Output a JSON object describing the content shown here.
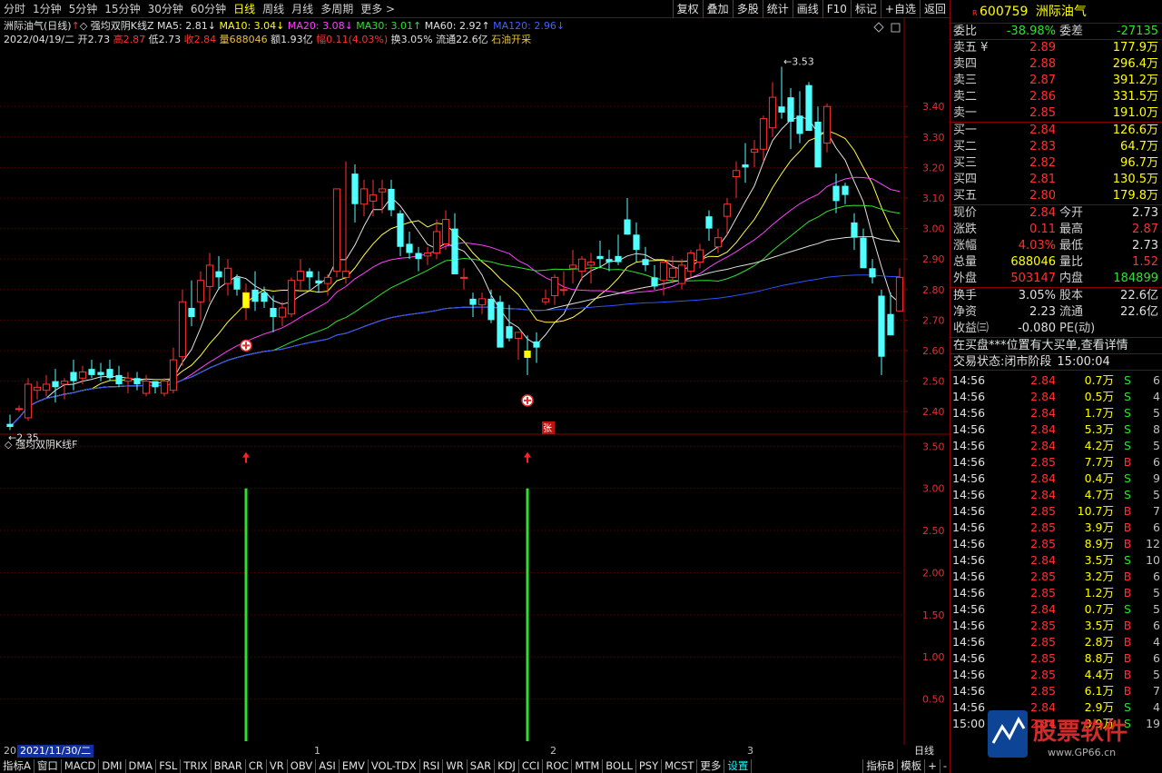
{
  "toolbar": {
    "periods": [
      "分时",
      "1分钟",
      "5分钟",
      "15分钟",
      "30分钟",
      "60分钟",
      "日线",
      "周线",
      "月线",
      "多周期",
      "更多 >"
    ],
    "active_period": "日线",
    "right_buttons": [
      "复权",
      "叠加",
      "多股",
      "统计",
      "画线",
      "F10",
      "标记",
      "+自选",
      "返回"
    ]
  },
  "info": {
    "line1": [
      {
        "t": "洲际油气(日线)",
        "c": "c-white"
      },
      {
        "t": "↑",
        "c": "c-red"
      },
      {
        "t": "◇ 强均双阴K线Z",
        "c": "c-white"
      },
      {
        "t": " MA5: 2.81↓",
        "c": "c-white"
      },
      {
        "t": " MA10: 3.04↓",
        "c": "c-yellow"
      },
      {
        "t": " MA20: 3.08↓",
        "c": "c-mag"
      },
      {
        "t": " MA30: 3.01↑",
        "c": "c-green"
      },
      {
        "t": " MA60: 2.92↑",
        "c": "c-white"
      },
      {
        "t": " MA120: 2.96↓",
        "c": "c-blue"
      }
    ],
    "line2": [
      {
        "t": "2022/04/19/二",
        "c": "c-white"
      },
      {
        "t": " 开2.73",
        "c": "c-white"
      },
      {
        "t": " 高2.87",
        "c": "c-red"
      },
      {
        "t": " 低2.73",
        "c": "c-white"
      },
      {
        "t": " 收2.84",
        "c": "c-red"
      },
      {
        "t": " 量688046",
        "c": "c-gold"
      },
      {
        "t": " 额1.93亿",
        "c": "c-white"
      },
      {
        "t": " 幅0.11(4.03%)",
        "c": "c-red"
      },
      {
        "t": " 换3.05%",
        "c": "c-white"
      },
      {
        "t": " 流通22.6亿",
        "c": "c-white"
      },
      {
        "t": " 石油开采",
        "c": "c-gold"
      }
    ]
  },
  "chart_data": [
    {
      "type": "candlestick",
      "title": "洲际油气(日线)",
      "yticks": [
        2.4,
        2.5,
        2.6,
        2.7,
        2.8,
        2.9,
        3.0,
        3.1,
        3.2,
        3.3,
        3.4
      ],
      "ylim": [
        2.35,
        3.6
      ],
      "annotations": {
        "high_label": "3.53",
        "low_label": "2.35",
        "zhang_mark": "张"
      },
      "ma_labels": {
        "ma5": "MA5",
        "ma10": "MA10",
        "ma20": "MA20",
        "ma30": "MA30",
        "ma60": "MA60",
        "ma120": "MA120"
      },
      "candles": [
        [
          2.36,
          2.39,
          2.34,
          2.35
        ],
        [
          2.41,
          2.42,
          2.4,
          2.41
        ],
        [
          2.38,
          2.51,
          2.37,
          2.49
        ],
        [
          2.47,
          2.5,
          2.44,
          2.48
        ],
        [
          2.47,
          2.52,
          2.45,
          2.49
        ],
        [
          2.5,
          2.54,
          2.43,
          2.48
        ],
        [
          2.49,
          2.51,
          2.44,
          2.5
        ],
        [
          2.53,
          2.57,
          2.47,
          2.5
        ],
        [
          2.51,
          2.55,
          2.49,
          2.53
        ],
        [
          2.54,
          2.57,
          2.51,
          2.52
        ],
        [
          2.53,
          2.56,
          2.5,
          2.52
        ],
        [
          2.54,
          2.57,
          2.5,
          2.51
        ],
        [
          2.52,
          2.55,
          2.48,
          2.49
        ],
        [
          2.5,
          2.53,
          2.46,
          2.51
        ],
        [
          2.51,
          2.53,
          2.47,
          2.49
        ],
        [
          2.46,
          2.52,
          2.45,
          2.5
        ],
        [
          2.5,
          2.5,
          2.46,
          2.48
        ],
        [
          2.46,
          2.51,
          2.45,
          2.5
        ],
        [
          2.47,
          2.61,
          2.46,
          2.57
        ],
        [
          2.58,
          2.8,
          2.55,
          2.76
        ],
        [
          2.74,
          2.83,
          2.68,
          2.71
        ],
        [
          2.76,
          2.86,
          2.7,
          2.83
        ],
        [
          2.81,
          2.92,
          2.76,
          2.88
        ],
        [
          2.86,
          2.91,
          2.8,
          2.84
        ],
        [
          2.82,
          2.9,
          2.78,
          2.87
        ],
        [
          2.84,
          2.85,
          2.78,
          2.8
        ],
        [
          2.74,
          2.82,
          2.7,
          2.79
        ],
        [
          2.8,
          2.86,
          2.73,
          2.76
        ],
        [
          2.79,
          2.81,
          2.74,
          2.76
        ],
        [
          2.74,
          2.78,
          2.66,
          2.71
        ],
        [
          2.71,
          2.76,
          2.68,
          2.74
        ],
        [
          2.72,
          2.84,
          2.71,
          2.83
        ],
        [
          2.83,
          2.9,
          2.8,
          2.86
        ],
        [
          2.86,
          2.87,
          2.8,
          2.84
        ],
        [
          2.83,
          2.86,
          2.79,
          2.82
        ],
        [
          2.82,
          2.85,
          2.78,
          2.84
        ],
        [
          2.86,
          3.13,
          2.84,
          3.13
        ],
        [
          2.84,
          3.22,
          2.82,
          2.86
        ],
        [
          3.18,
          3.21,
          3.02,
          3.08
        ],
        [
          3.08,
          3.16,
          3.04,
          3.13
        ],
        [
          3.09,
          3.16,
          3.04,
          3.11
        ],
        [
          3.12,
          3.16,
          3.05,
          3.13
        ],
        [
          3.13,
          3.16,
          3.04,
          3.06
        ],
        [
          3.05,
          3.06,
          2.91,
          2.94
        ],
        [
          2.95,
          2.99,
          2.9,
          2.92
        ],
        [
          2.92,
          2.94,
          2.86,
          2.9
        ],
        [
          2.91,
          2.94,
          2.88,
          2.92
        ],
        [
          2.92,
          3.03,
          2.9,
          2.99
        ],
        [
          2.95,
          3.06,
          2.93,
          3.03
        ],
        [
          3.0,
          3.05,
          2.87,
          2.85
        ],
        [
          2.84,
          2.87,
          2.8,
          2.84
        ],
        [
          2.77,
          2.79,
          2.71,
          2.75
        ],
        [
          2.75,
          2.79,
          2.72,
          2.77
        ],
        [
          2.77,
          2.8,
          2.69,
          2.7
        ],
        [
          2.76,
          2.78,
          2.62,
          2.61
        ],
        [
          2.68,
          2.75,
          2.63,
          2.64
        ],
        [
          2.64,
          2.66,
          2.57,
          2.66
        ],
        [
          2.6,
          2.65,
          2.52,
          2.58
        ],
        [
          2.63,
          2.66,
          2.56,
          2.61
        ],
        [
          2.76,
          2.8,
          2.75,
          2.77
        ],
        [
          2.78,
          2.85,
          2.75,
          2.84
        ],
        [
          2.8,
          2.86,
          2.78,
          2.8
        ],
        [
          2.87,
          2.93,
          2.82,
          2.88
        ],
        [
          2.86,
          2.91,
          2.83,
          2.9
        ],
        [
          2.88,
          2.92,
          2.82,
          2.89
        ],
        [
          2.91,
          2.96,
          2.87,
          2.9
        ],
        [
          2.9,
          2.93,
          2.86,
          2.89
        ],
        [
          2.91,
          2.98,
          2.88,
          2.89
        ],
        [
          3.03,
          3.1,
          2.98,
          2.98
        ],
        [
          2.98,
          3.02,
          2.89,
          2.93
        ],
        [
          2.9,
          2.94,
          2.86,
          2.88
        ],
        [
          2.84,
          2.88,
          2.8,
          2.81
        ],
        [
          2.83,
          2.89,
          2.78,
          2.89
        ],
        [
          2.84,
          2.91,
          2.82,
          2.87
        ],
        [
          2.82,
          2.9,
          2.8,
          2.88
        ],
        [
          2.86,
          2.93,
          2.84,
          2.92
        ],
        [
          2.89,
          2.95,
          2.87,
          2.93
        ],
        [
          3.04,
          3.06,
          2.96,
          3.0
        ],
        [
          2.94,
          3.0,
          2.92,
          2.97
        ],
        [
          3.04,
          3.1,
          2.98,
          3.08
        ],
        [
          3.17,
          3.22,
          3.1,
          3.19
        ],
        [
          3.21,
          3.28,
          3.15,
          3.2
        ],
        [
          3.25,
          3.29,
          3.2,
          3.26
        ],
        [
          3.26,
          3.37,
          3.22,
          3.36
        ],
        [
          3.33,
          3.48,
          3.3,
          3.43
        ],
        [
          3.4,
          3.53,
          3.36,
          3.38
        ],
        [
          3.43,
          3.46,
          3.26,
          3.35
        ],
        [
          3.37,
          3.45,
          3.28,
          3.31
        ],
        [
          3.47,
          3.48,
          3.33,
          3.32
        ],
        [
          3.35,
          3.4,
          3.21,
          3.2
        ],
        [
          3.28,
          3.41,
          3.25,
          3.4
        ],
        [
          3.14,
          3.18,
          3.05,
          3.09
        ],
        [
          3.14,
          3.15,
          3.08,
          3.11
        ],
        [
          3.02,
          3.05,
          2.93,
          2.97
        ],
        [
          2.97,
          3.0,
          2.88,
          2.87
        ],
        [
          2.87,
          2.9,
          2.82,
          2.84
        ],
        [
          2.78,
          2.8,
          2.52,
          2.58
        ],
        [
          2.72,
          2.79,
          2.67,
          2.65
        ],
        [
          2.73,
          2.87,
          2.73,
          2.84
        ]
      ]
    },
    {
      "type": "bar",
      "title": "强均双阴K线F",
      "yticks": [
        0.5,
        1.0,
        1.5,
        2.0,
        2.5,
        3.0,
        3.5
      ],
      "ylim": [
        0.0,
        3.6
      ],
      "signals": [
        {
          "index": 26,
          "value": 3.0
        },
        {
          "index": 57,
          "value": 3.0
        }
      ]
    }
  ],
  "datebar": {
    "left": "20",
    "selected": "2021/11/30/二",
    "months": [
      "1",
      "2",
      "3"
    ]
  },
  "bottom_tabs": [
    "指标A",
    "窗口",
    "MACD",
    "DMI",
    "DMA",
    "FSL",
    "TRIX",
    "BRAR",
    "CR",
    "VR",
    "OBV",
    "ASI",
    "EMV",
    "VOL-TDX",
    "RSI",
    "WR",
    "SAR",
    "KDJ",
    "CCI",
    "ROC",
    "MTM",
    "BOLL",
    "PSY",
    "MCST",
    "更多",
    "设置"
  ],
  "bottom_active": "设置",
  "bottom_right": [
    "指标B",
    "模板",
    "+",
    "-"
  ],
  "right_axis_label": "日线",
  "stock": {
    "badge": "R",
    "code": "600759",
    "name": "洲际油气"
  },
  "weibi": {
    "label": "委比",
    "value": "-38.98%",
    "label2": "委差",
    "value2": "-27135"
  },
  "sell": [
    {
      "l": "卖五 ¥",
      "p": "2.89",
      "v": "177.9万"
    },
    {
      "l": "卖四",
      "p": "2.88",
      "v": "296.4万"
    },
    {
      "l": "卖三",
      "p": "2.87",
      "v": "391.2万"
    },
    {
      "l": "卖二",
      "p": "2.86",
      "v": "331.5万"
    },
    {
      "l": "卖一",
      "p": "2.85",
      "v": "191.0万"
    }
  ],
  "buy": [
    {
      "l": "买一",
      "p": "2.84",
      "v": "126.6万"
    },
    {
      "l": "买二",
      "p": "2.83",
      "v": "64.7万"
    },
    {
      "l": "买三",
      "p": "2.82",
      "v": "96.7万"
    },
    {
      "l": "买四",
      "p": "2.81",
      "v": "130.5万"
    },
    {
      "l": "买五",
      "p": "2.80",
      "v": "179.8万"
    }
  ],
  "stats1": [
    {
      "a": "现价",
      "b": "2.84",
      "bc": "c-red",
      "c": "今开",
      "d": "2.73",
      "dc": "c-white"
    },
    {
      "a": "涨跌",
      "b": "0.11",
      "bc": "c-red",
      "c": "最高",
      "d": "2.87",
      "dc": "c-red"
    },
    {
      "a": "涨幅",
      "b": "4.03%",
      "bc": "c-red",
      "c": "最低",
      "d": "2.73",
      "dc": "c-white"
    },
    {
      "a": "总量",
      "b": "688046",
      "bc": "c-yellow",
      "c": "量比",
      "d": "1.52",
      "dc": "c-red"
    },
    {
      "a": "外盘",
      "b": "503147",
      "bc": "c-red",
      "c": "内盘",
      "d": "184899",
      "dc": "c-green"
    }
  ],
  "stats2": [
    {
      "a": "换手",
      "b": "3.05%",
      "bc": "c-white",
      "c": "股本",
      "d": "22.6亿",
      "dc": "c-white"
    },
    {
      "a": "净资",
      "b": "2.23",
      "bc": "c-white",
      "c": "流通",
      "d": "22.6亿",
      "dc": "c-white"
    },
    {
      "a": "收益㈢",
      "b": "-0.080",
      "bc": "c-white",
      "c": "PE(动)",
      "d": "",
      "dc": "c-white"
    }
  ],
  "notice": "在买盘***位置有大买单,查看详情",
  "trade_state": {
    "label": "交易状态:",
    "value": "闭市阶段",
    "time": "15:00:04"
  },
  "ticks": [
    {
      "t": "14:56",
      "p": "2.84",
      "v": "0.7万",
      "bs": "S",
      "n": "6"
    },
    {
      "t": "14:56",
      "p": "2.84",
      "v": "0.5万",
      "bs": "S",
      "n": "4"
    },
    {
      "t": "14:56",
      "p": "2.84",
      "v": "1.7万",
      "bs": "S",
      "n": "5"
    },
    {
      "t": "14:56",
      "p": "2.84",
      "v": "5.3万",
      "bs": "S",
      "n": "8"
    },
    {
      "t": "14:56",
      "p": "2.84",
      "v": "4.2万",
      "bs": "S",
      "n": "5"
    },
    {
      "t": "14:56",
      "p": "2.85",
      "v": "7.7万",
      "bs": "B",
      "n": "6"
    },
    {
      "t": "14:56",
      "p": "2.84",
      "v": "0.4万",
      "bs": "S",
      "n": "9"
    },
    {
      "t": "14:56",
      "p": "2.84",
      "v": "4.7万",
      "bs": "S",
      "n": "5"
    },
    {
      "t": "14:56",
      "p": "2.85",
      "v": "10.7万",
      "bs": "B",
      "n": "7"
    },
    {
      "t": "14:56",
      "p": "2.85",
      "v": "3.9万",
      "bs": "B",
      "n": "6"
    },
    {
      "t": "14:56",
      "p": "2.85",
      "v": "8.9万",
      "bs": "B",
      "n": "12"
    },
    {
      "t": "14:56",
      "p": "2.84",
      "v": "3.5万",
      "bs": "S",
      "n": "10"
    },
    {
      "t": "14:56",
      "p": "2.85",
      "v": "3.2万",
      "bs": "B",
      "n": "6"
    },
    {
      "t": "14:56",
      "p": "2.85",
      "v": "1.2万",
      "bs": "B",
      "n": "5"
    },
    {
      "t": "14:56",
      "p": "2.84",
      "v": "0.7万",
      "bs": "S",
      "n": "5"
    },
    {
      "t": "14:56",
      "p": "2.85",
      "v": "3.5万",
      "bs": "B",
      "n": "6"
    },
    {
      "t": "14:56",
      "p": "2.85",
      "v": "2.8万",
      "bs": "B",
      "n": "4"
    },
    {
      "t": "14:56",
      "p": "2.85",
      "v": "8.8万",
      "bs": "B",
      "n": "6"
    },
    {
      "t": "14:56",
      "p": "2.85",
      "v": "4.4万",
      "bs": "B",
      "n": "5"
    },
    {
      "t": "14:56",
      "p": "2.85",
      "v": "6.1万",
      "bs": "B",
      "n": "7"
    },
    {
      "t": "14:56",
      "p": "2.84",
      "v": "2.9万",
      "bs": "S",
      "n": "4"
    },
    {
      "t": "15:00",
      "p": "2.84",
      "v": "3.9万",
      "bs": "S",
      "n": "19"
    }
  ],
  "watermark": {
    "brand": "股票软件",
    "url": "www.GP66.cn"
  },
  "colors": {
    "up": "#ff3030",
    "down": "#50ffff",
    "signal": "#30e030",
    "ma5": "#e0e0e0",
    "ma10": "#ffff40",
    "ma20": "#ff40ff",
    "ma30": "#30e030",
    "ma60": "#e0e0e0",
    "ma120": "#3050ff"
  }
}
